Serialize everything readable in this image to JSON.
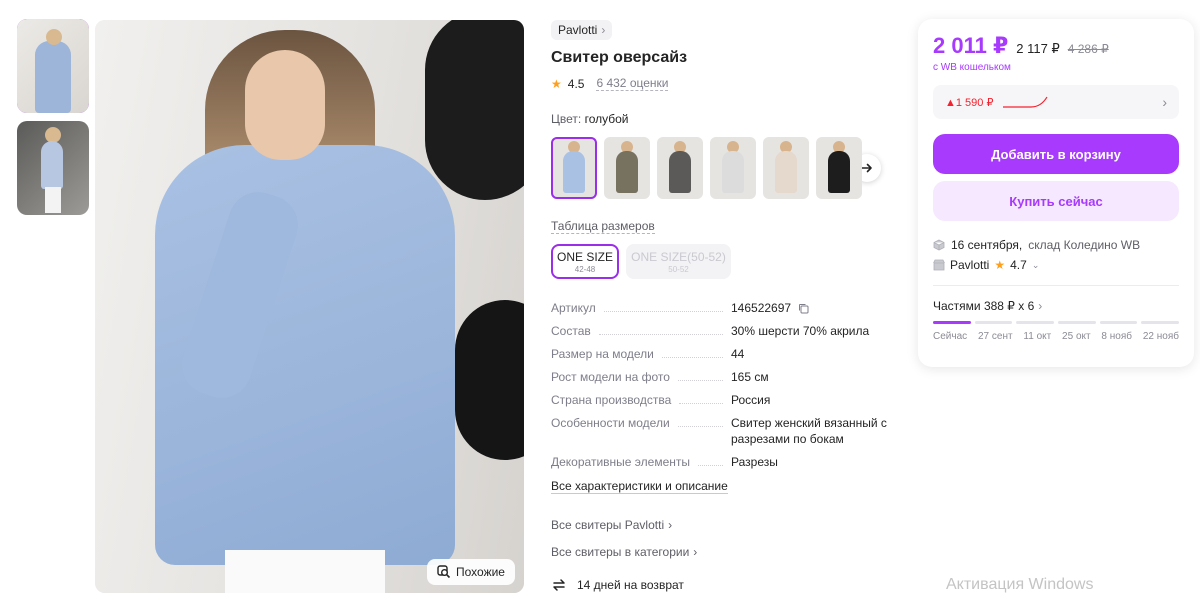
{
  "thumbnails": [
    {
      "label": "photo-1",
      "active": true
    },
    {
      "label": "photo-2",
      "active": false
    }
  ],
  "photo": {
    "similar_label": "Похожие"
  },
  "product": {
    "brand": "Pavlotti",
    "title": "Свитер оверсайз",
    "rating": "4.5",
    "reviews": "6 432 оценки",
    "color_key": "Цвет:",
    "color_value": "голубой",
    "swatch_colors": [
      "#a9c1e3",
      "#77715f",
      "#5c5a58",
      "#dcdcdc",
      "#e5d8cc",
      "#1d1d1d"
    ],
    "size_table_link": "Таблица размеров",
    "sizes": [
      {
        "main": "ONE SIZE",
        "sub": "42-48",
        "state": "active"
      },
      {
        "main": "ONE SIZE(50-52)",
        "sub": "50-52",
        "state": "disabled"
      }
    ]
  },
  "specs": [
    {
      "key": "Артикул",
      "value": "146522697"
    },
    {
      "key": "Состав",
      "value": "30% шерсти 70% акрила"
    },
    {
      "key": "Размер на модели",
      "value": "44"
    },
    {
      "key": "Рост модели на фото",
      "value": "165 см"
    },
    {
      "key": "Страна производства",
      "value": "Россия"
    },
    {
      "key": "Особенности модели",
      "value": "Свитер женский вязанный с разрезами по бокам"
    },
    {
      "key": "Декоративные элементы",
      "value": "Разрезы"
    }
  ],
  "links": {
    "all_specs": "Все характеристики и описание",
    "all_brand": "Все свитеры Pavlotti",
    "all_category": "Все свитеры в категории",
    "returns": "14 дней на возврат"
  },
  "panel": {
    "price": "2 011 ₽",
    "price_alt": "2 117 ₽",
    "price_old": "4 286 ₽",
    "wallet_note": "с WB кошельком",
    "history_delta": "▲1 590 ₽",
    "add_to_cart": "Добавить в корзину",
    "buy_now": "Купить сейчас",
    "delivery_date": "16 сентября,",
    "delivery_wh": "склад Коледино WB",
    "seller_name": "Pavlotti",
    "seller_rating": "4.7",
    "installments": "Частями 388 ₽ х 6",
    "installment_dates": [
      "Сейчас",
      "27 сент",
      "11 окт",
      "25 окт",
      "8 нояб",
      "22 нояб"
    ],
    "installments_paid": 1
  },
  "watermark": "Активация Windows",
  "colors": {
    "accent": "#a73afd",
    "accent_light": "#f6e8ff",
    "up": "#f5222d",
    "star": "#ff9f1c"
  }
}
